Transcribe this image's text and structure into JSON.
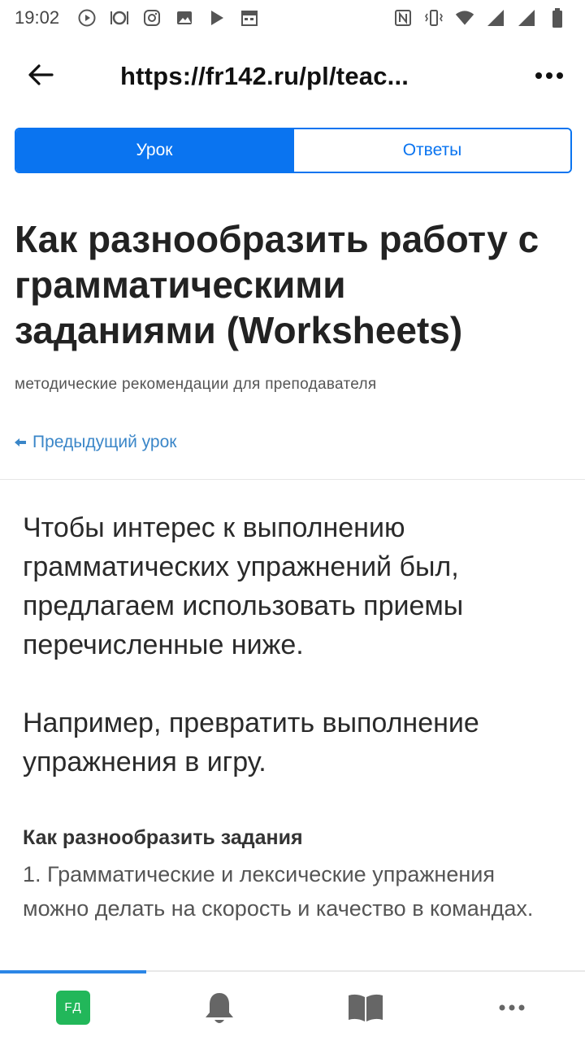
{
  "status_bar": {
    "time": "19:02",
    "left_icons": [
      "play-circle-icon",
      "restaurant-icon",
      "instagram-icon",
      "image-icon",
      "play-store-icon",
      "calendar-icon"
    ],
    "right_icons": [
      "nfc-icon",
      "vibrate-icon",
      "wifi-icon",
      "signal-icon",
      "signal-icon",
      "battery-icon"
    ]
  },
  "browser": {
    "url": "https://fr142.ru/pl/teac...",
    "back_icon": "arrow-left-icon",
    "more_icon": "more-dots-icon"
  },
  "tabs": [
    {
      "label": "Урок",
      "active": true
    },
    {
      "label": "Ответы",
      "active": false
    }
  ],
  "lesson": {
    "title_lines": [
      "Как разнообразить работу с",
      "грамматическими",
      "заданиями (Worksheets)"
    ],
    "subtitle": "методические рекомендации для преподавателя",
    "prev_link": "Предыдущий урок",
    "intro_p1_lines": [
      "Чтобы интерес к выполнению",
      "грамматических упражнений был,",
      "предлагаем использовать приемы",
      "перечисленные ниже."
    ],
    "intro_p2_lines": [
      "Например, превратить выполнение",
      "упражнения в игру."
    ],
    "section_heading": "Как разнообразить задания",
    "section_text_lines": [
      "1. Грамматические и лексические упражнения",
      "можно делать на скорость и качество в командах."
    ]
  },
  "bottom_nav": {
    "avatar_initials": "FД",
    "items": [
      "avatar",
      "bell-icon",
      "book-icon",
      "more-dots-icon"
    ],
    "progress": 0.25
  },
  "colors": {
    "accent": "#0a74f0",
    "link": "#3a86c8",
    "avatar_bg": "#22b75a"
  }
}
